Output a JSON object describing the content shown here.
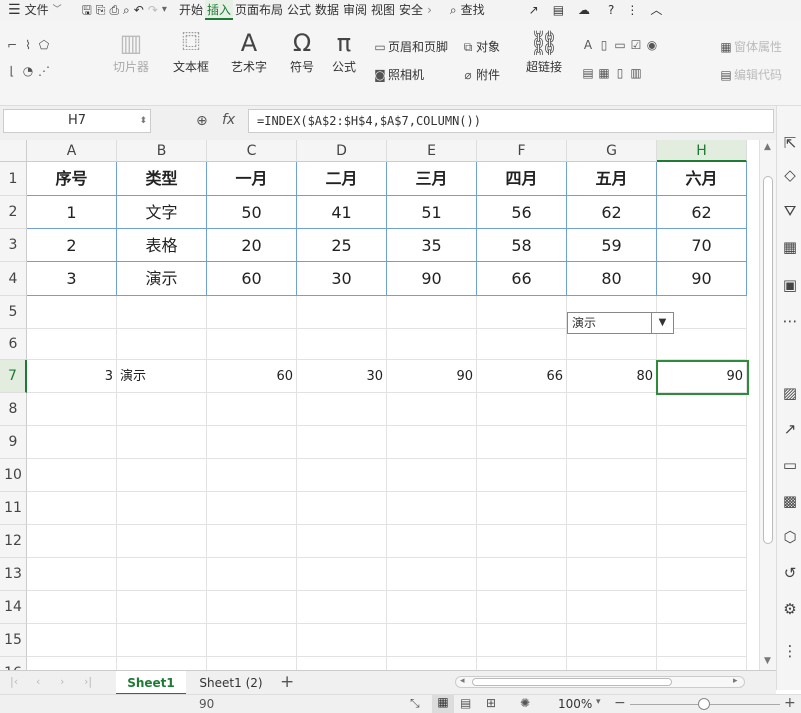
{
  "menubar": {
    "file": "文件",
    "tabs": [
      "开始",
      "插入",
      "页面布局",
      "公式",
      "数据",
      "审阅",
      "视图",
      "安全"
    ],
    "active_tab": "插入",
    "search": "查找"
  },
  "ribbon": {
    "slicer": "切片器",
    "textbox": "文本框",
    "wordart": "艺术字",
    "symbol": "符号",
    "formula": "公式",
    "header_footer": "页眉和页脚",
    "object": "对象",
    "camera": "照相机",
    "attachment": "附件",
    "hyperlink": "超链接",
    "form_properties": "窗体属性",
    "edit_code": "编辑代码"
  },
  "formulabar": {
    "cell_ref": "H7",
    "fx": "fx",
    "formula": "=INDEX($A$2:$H$4,$A$7,COLUMN())"
  },
  "columns": [
    "A",
    "B",
    "C",
    "D",
    "E",
    "F",
    "G",
    "H"
  ],
  "rows": [
    "1",
    "2",
    "3",
    "4",
    "5",
    "6",
    "7",
    "8",
    "9",
    "10",
    "11",
    "12",
    "13",
    "14",
    "15",
    "16"
  ],
  "table": {
    "header": [
      "序号",
      "类型",
      "一月",
      "二月",
      "三月",
      "四月",
      "五月",
      "六月"
    ],
    "body": [
      [
        "1",
        "文字",
        "50",
        "41",
        "51",
        "56",
        "62",
        "62"
      ],
      [
        "2",
        "表格",
        "20",
        "25",
        "35",
        "58",
        "59",
        "70"
      ],
      [
        "3",
        "演示",
        "60",
        "30",
        "90",
        "66",
        "80",
        "90"
      ]
    ]
  },
  "row7": [
    "3",
    "演示",
    "60",
    "30",
    "90",
    "66",
    "80",
    "90"
  ],
  "dropdown": {
    "value": "演示"
  },
  "sheets": [
    "Sheet1",
    "Sheet1 (2)"
  ],
  "status": {
    "sum": "90",
    "zoom": "100%"
  }
}
